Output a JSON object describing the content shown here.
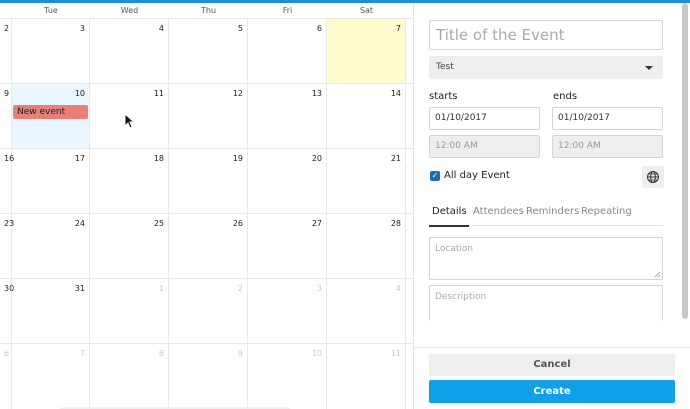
{
  "calendar": {
    "weekdays": [
      "Tue",
      "Wed",
      "Thu",
      "Fri",
      "Sat"
    ],
    "weeks": [
      {
        "left": "2",
        "days": [
          "3",
          "4",
          "5",
          "6",
          "7"
        ]
      },
      {
        "left": "9",
        "days": [
          "10",
          "11",
          "12",
          "13",
          "14"
        ]
      },
      {
        "left": "16",
        "days": [
          "17",
          "18",
          "19",
          "20",
          "21"
        ]
      },
      {
        "left": "23",
        "days": [
          "24",
          "25",
          "26",
          "27",
          "28"
        ]
      },
      {
        "left": "30",
        "days": [
          "31",
          "1",
          "2",
          "3",
          "4"
        ]
      },
      {
        "left": "6",
        "days": [
          "7",
          "8",
          "9",
          "10",
          "11"
        ]
      }
    ],
    "event_label": "New event",
    "today_color": "#fffbcc",
    "selected_color": "#e9f6fd",
    "event_color": "#e8807a"
  },
  "editor": {
    "title_placeholder": "Title of the Event",
    "calendar_select": "Test",
    "starts_label": "starts",
    "ends_label": "ends",
    "start_date": "01/10/2017",
    "end_date": "01/10/2017",
    "start_time": "12:00 AM",
    "end_time": "12:00 AM",
    "all_day_label": "All day Event",
    "all_day_checked": true,
    "tabs": [
      "Details",
      "Attendees",
      "Reminders",
      "Repeating"
    ],
    "location_placeholder": "Location",
    "description_placeholder": "Description",
    "cancel_label": "Cancel",
    "create_label": "Create",
    "accent_color": "#0fa0e8"
  }
}
